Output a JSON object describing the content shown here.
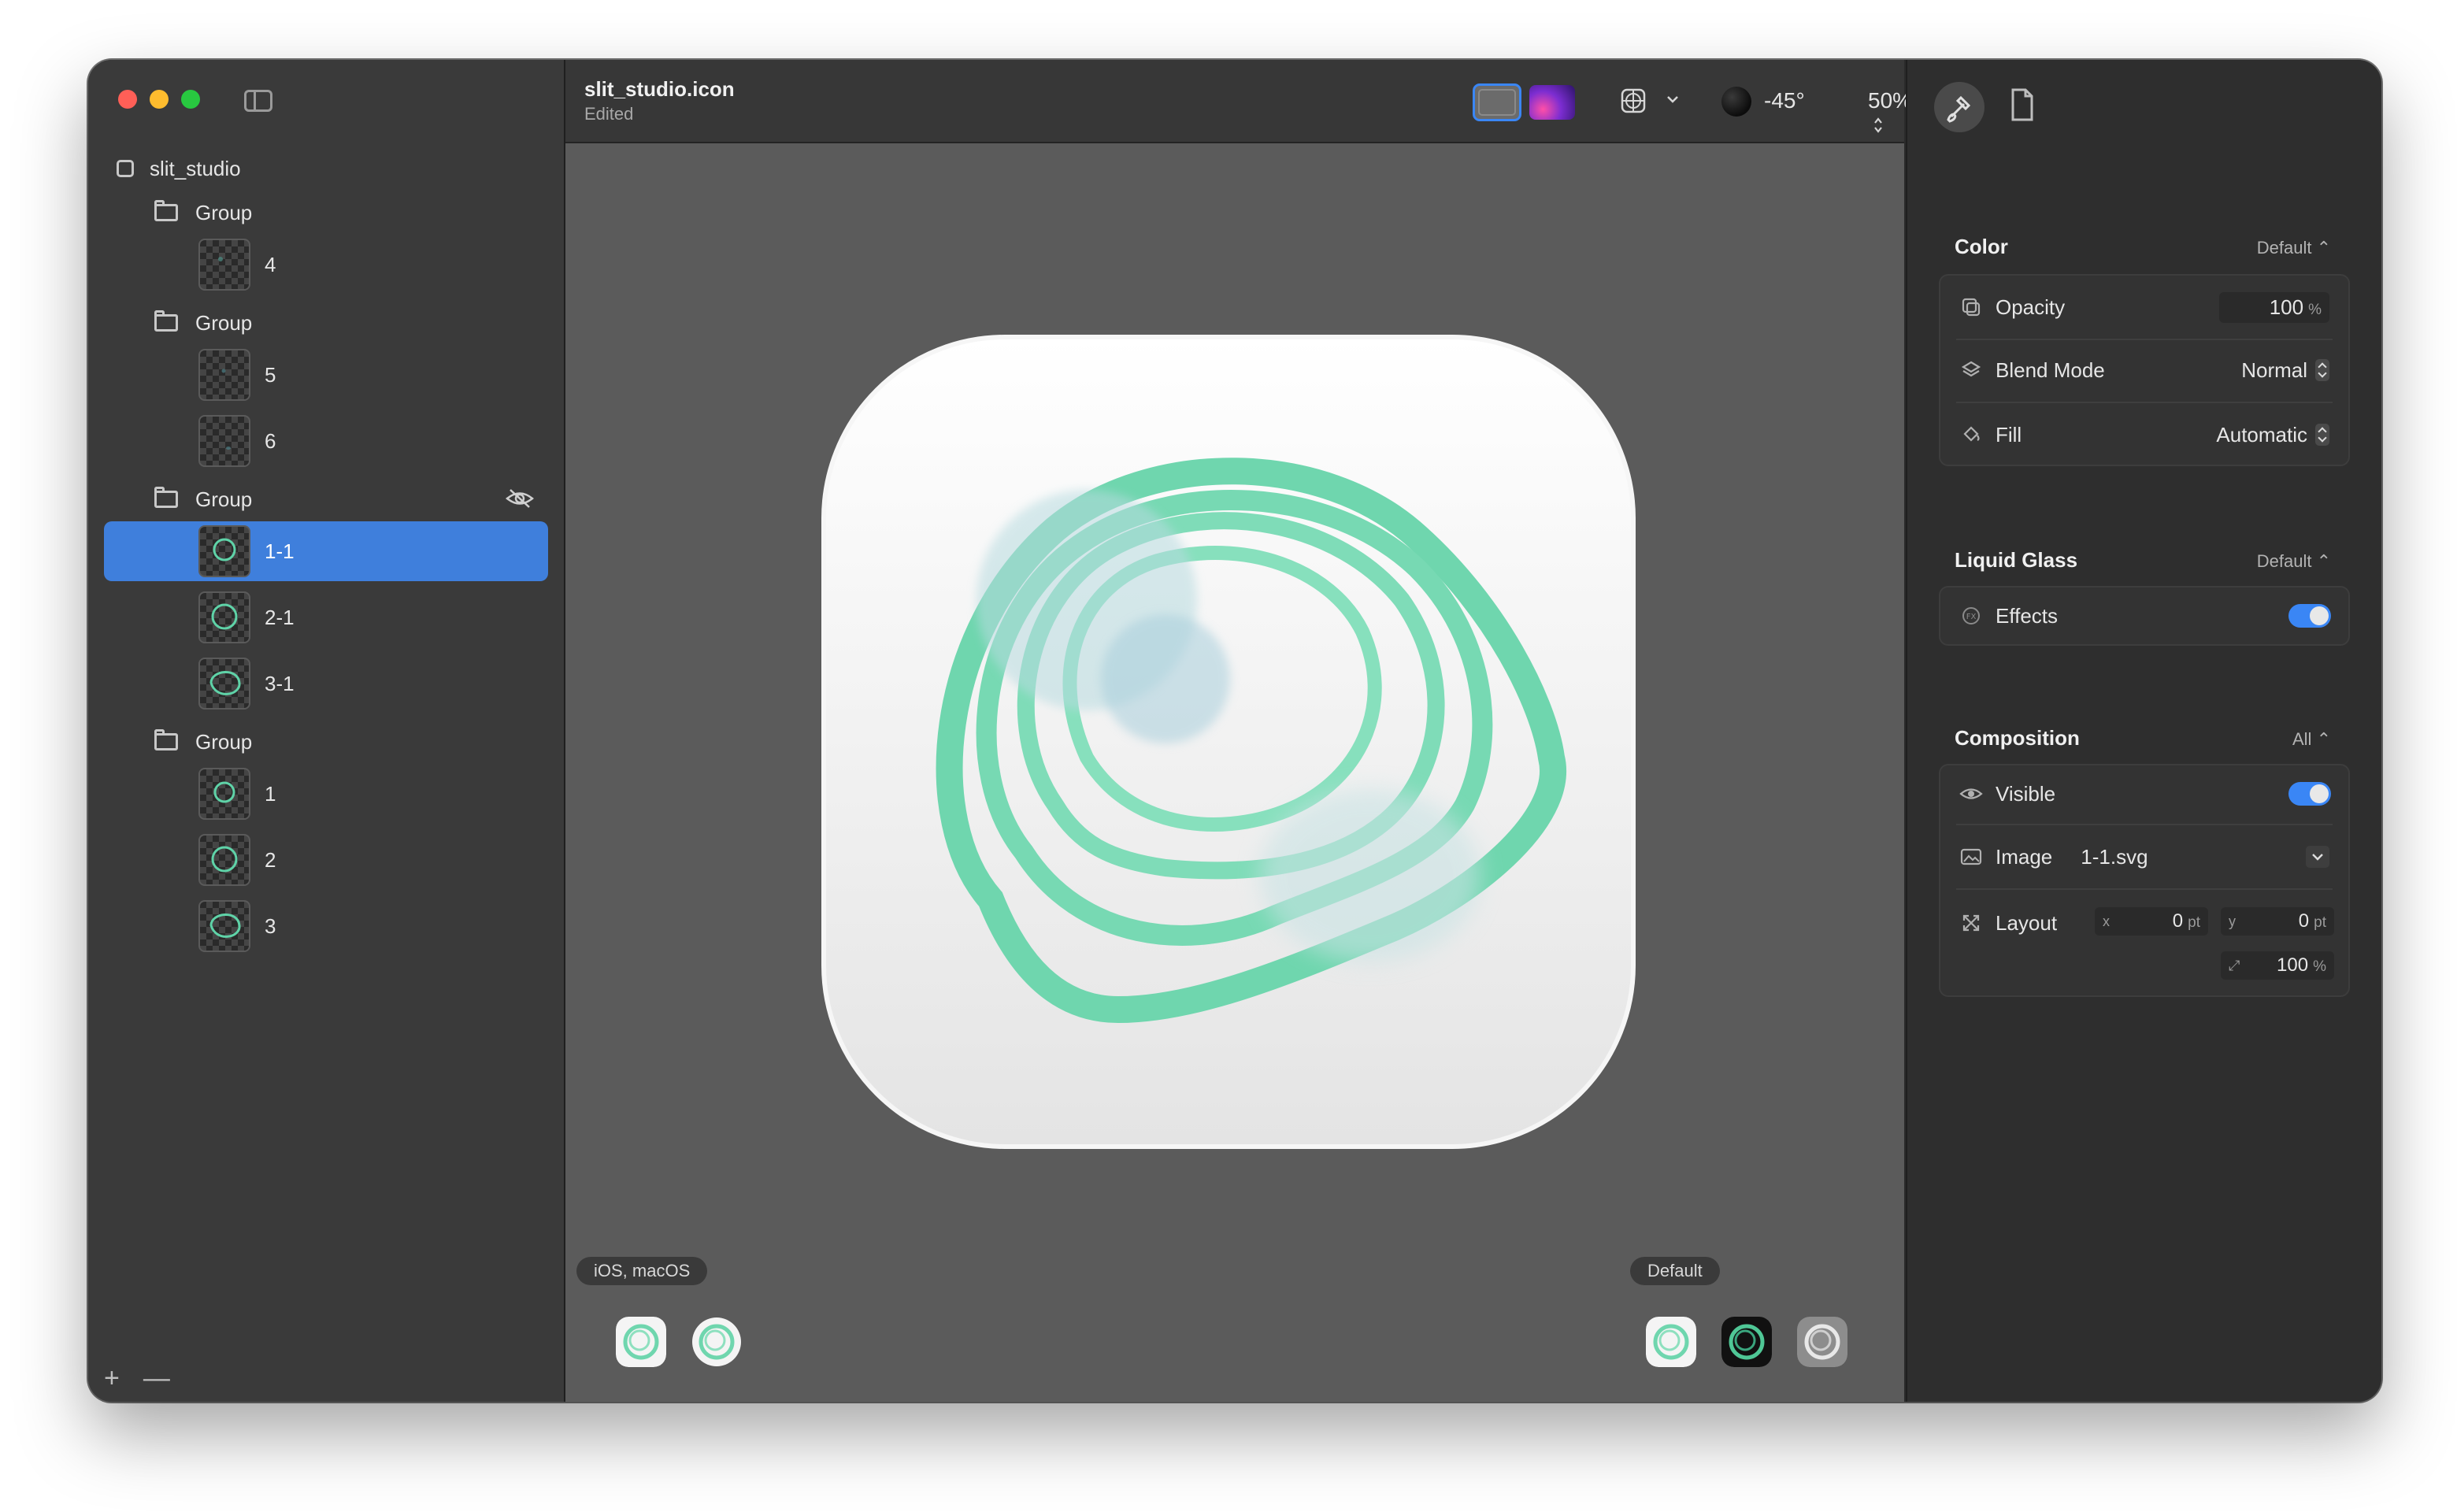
{
  "window": {
    "traffic_lights": {
      "close": "#ff5f57",
      "minimize": "#febc2e",
      "zoom": "#28c840"
    }
  },
  "sidebar": {
    "project": "slit_studio",
    "items": [
      {
        "type": "group",
        "label": "Group"
      },
      {
        "type": "layer",
        "label": "4"
      },
      {
        "type": "group",
        "label": "Group"
      },
      {
        "type": "layer",
        "label": "5"
      },
      {
        "type": "layer",
        "label": "6"
      },
      {
        "type": "group",
        "label": "Group",
        "hidden": true
      },
      {
        "type": "layer",
        "label": "1-1",
        "selected": true
      },
      {
        "type": "layer",
        "label": "2-1"
      },
      {
        "type": "layer",
        "label": "3-1"
      },
      {
        "type": "group",
        "label": "Group"
      },
      {
        "type": "layer",
        "label": "1"
      },
      {
        "type": "layer",
        "label": "2"
      },
      {
        "type": "layer",
        "label": "3"
      }
    ],
    "add_label": "+",
    "remove_label": "—"
  },
  "toolbar": {
    "title": "slit_studio.icon",
    "subtitle": "Edited",
    "light_angle": "-45°",
    "zoom": "50%"
  },
  "canvas": {
    "platform_label": "iOS, macOS",
    "appearance_label": "Default",
    "accent": "#5fd3a8"
  },
  "inspector": {
    "color": {
      "title": "Color",
      "preset": "Default",
      "opacity_label": "Opacity",
      "opacity_value": "100",
      "opacity_unit": "%",
      "blend_label": "Blend Mode",
      "blend_value": "Normal",
      "fill_label": "Fill",
      "fill_value": "Automatic"
    },
    "liquid_glass": {
      "title": "Liquid Glass",
      "preset": "Default",
      "effects_label": "Effects",
      "effects_on": true
    },
    "composition": {
      "title": "Composition",
      "preset": "All",
      "visible_label": "Visible",
      "visible_on": true,
      "image_label": "Image",
      "image_value": "1-1.svg",
      "layout_label": "Layout",
      "x_label": "x",
      "x_value": "0",
      "y_label": "y",
      "y_value": "0",
      "pt_unit": "pt",
      "scale_value": "100",
      "scale_unit": "%"
    },
    "toggle_color": "#3a86f5"
  }
}
